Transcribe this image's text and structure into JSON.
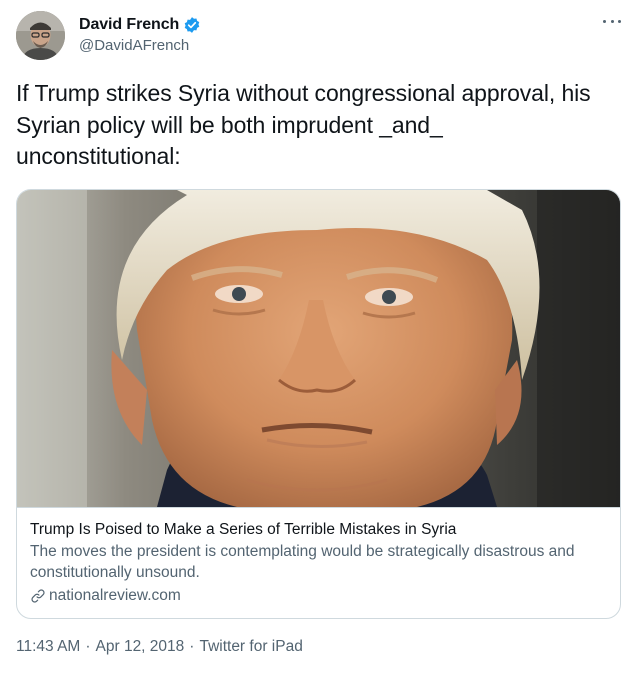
{
  "author": {
    "display_name": "David French",
    "handle": "@DavidAFrench",
    "verified": true,
    "avatar_icon": "profile-photo"
  },
  "tweet": {
    "text_line1": "If Trump strikes Syria without congressional approval, his",
    "text_line2": "Syrian policy will be both imprudent _and_",
    "text_line3": "unconstitutional:"
  },
  "card": {
    "image_icon": "headline-photo",
    "title": "Trump Is Poised to Make a Series of Terrible Mistakes in Syria",
    "description": "The moves the president is contemplating would be strategically disastrous and constitutionally unsound.",
    "domain": "nationalreview.com"
  },
  "meta": {
    "time": "11:43 AM",
    "separator": "·",
    "date": "Apr 12, 2018",
    "source": "Twitter for iPad"
  },
  "colors": {
    "primary_text": "#0f1419",
    "secondary_text": "#536471",
    "border": "#cfd9de",
    "verified_blue": "#1d9bf0"
  }
}
